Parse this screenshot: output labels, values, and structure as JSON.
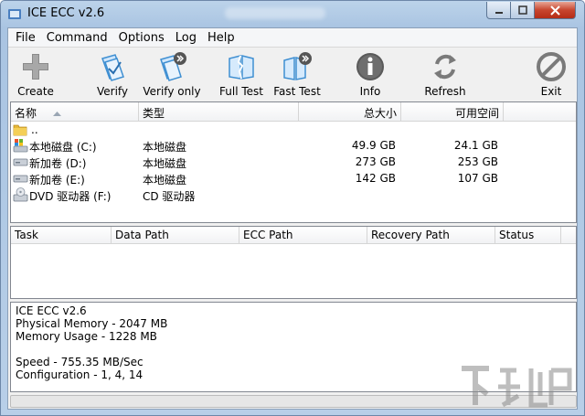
{
  "window": {
    "title": "ICE ECC v2.6"
  },
  "menu": [
    "File",
    "Command",
    "Options",
    "Log",
    "Help"
  ],
  "toolbar": [
    {
      "label": "Create",
      "icon": "plus-icon"
    },
    {
      "label": "Verify",
      "icon": "verify-icon"
    },
    {
      "label": "Verify only",
      "icon": "verify-only-icon"
    },
    {
      "label": "Full Test",
      "icon": "full-test-icon"
    },
    {
      "label": "Fast Test",
      "icon": "fast-test-icon"
    },
    {
      "label": "Info",
      "icon": "info-icon"
    },
    {
      "label": "Refresh",
      "icon": "refresh-icon"
    },
    {
      "label": "Exit",
      "icon": "exit-icon"
    }
  ],
  "drives": {
    "columns": [
      "名称",
      "类型",
      "总大小",
      "可用空间"
    ],
    "rows": [
      {
        "name": "..",
        "type": "",
        "total": "",
        "free": "",
        "icon": "folder-icon"
      },
      {
        "name": "本地磁盘 (C:)",
        "type": "本地磁盘",
        "total": "49.9 GB",
        "free": "24.1 GB",
        "icon": "system-drive-icon"
      },
      {
        "name": "新加卷 (D:)",
        "type": "本地磁盘",
        "total": "273 GB",
        "free": "253 GB",
        "icon": "drive-icon"
      },
      {
        "name": "新加卷 (E:)",
        "type": "本地磁盘",
        "total": "142 GB",
        "free": "107 GB",
        "icon": "drive-icon"
      },
      {
        "name": "DVD 驱动器 (F:)",
        "type": "CD 驱动器",
        "total": "",
        "free": "",
        "icon": "dvd-drive-icon"
      }
    ]
  },
  "tasks": {
    "columns": [
      "Task",
      "Data Path",
      "ECC Path",
      "Recovery Path",
      "Status"
    ]
  },
  "info": {
    "lines": [
      "ICE ECC v2.6",
      "Physical Memory - 2047 MB",
      "Memory Usage - 1228 MB",
      "",
      "Speed - 755.35 MB/Sec",
      "Configuration - 1, 4, 14"
    ]
  },
  "progress": 0,
  "colors": {
    "title_bar": "#b9d1ea",
    "close_button": "#c7452e",
    "info_icon": "#555555",
    "refresh_icon": "#7a7a7a",
    "verify_icon": "#3f8fd2"
  }
}
